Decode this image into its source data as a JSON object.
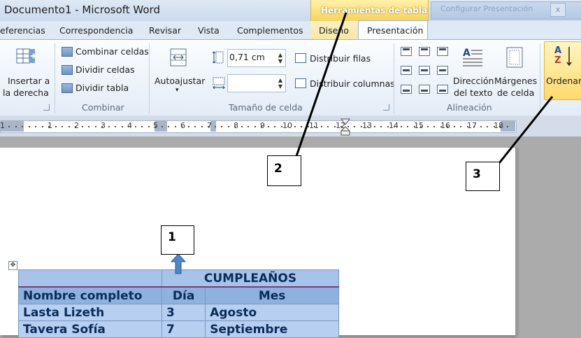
{
  "window": {
    "title": "Documento1  -  Microsoft Word",
    "context_group": "Herramientas de tabla",
    "background_window": "Configurar Presentación",
    "background_close": "x"
  },
  "tabs": {
    "referencias": "eferencias",
    "correspondencia": "Correspondencia",
    "revisar": "Revisar",
    "vista": "Vista",
    "complementos": "Complementos",
    "diseno": "Diseño",
    "presentacion": "Presentación"
  },
  "ribbon": {
    "insert_right_line1": "Insertar a",
    "insert_right_line2": "la derecha",
    "combinar_celdas": "Combinar celdas",
    "dividir_celdas": "Dividir celdas",
    "dividir_tabla": "Dividir tabla",
    "group_combinar": "Combinar",
    "autoajustar": "Autoajustar",
    "autoajustar_arrow": "▾",
    "height_value": "0,71 cm",
    "width_value": "",
    "distribuir_filas": "Distribuir filas",
    "distribuir_columnas": "Distribuir columnas",
    "group_tamano": "Tamaño de celda",
    "direccion_line1": "Dirección",
    "direccion_line2": "del texto",
    "margenes_line1": "Márgenes",
    "margenes_line2": "de celda",
    "group_alineacion": "Alineación",
    "ordenar": "Ordenar",
    "sort_az_top": "A",
    "sort_az_bottom": "Z"
  },
  "ruler": {
    "left_labels": [
      "1",
      "1",
      "2",
      "3",
      "4",
      "5"
    ],
    "right_labels": [
      "6",
      "7",
      "8",
      "9",
      "10",
      "11",
      "12",
      "13",
      "14",
      "15",
      "16",
      "17",
      "18"
    ]
  },
  "callouts": {
    "one": "1",
    "two": "2",
    "three": "3"
  },
  "table": {
    "title": "CUMPLEAÑOS",
    "headers": [
      "Nombre completo",
      "Día",
      "Mes"
    ],
    "rows": [
      [
        "Lasta Lizeth",
        "3",
        "Agosto"
      ],
      [
        "Tavera Sofía",
        "7",
        "Septiembre"
      ]
    ]
  },
  "colors": {
    "context_tab": "#f5d45c",
    "ordenar_highlight": "#ffd96b",
    "table_header": "#8eb1e0",
    "table_row": "#b7cff0",
    "table_text": "#0b2b57"
  }
}
